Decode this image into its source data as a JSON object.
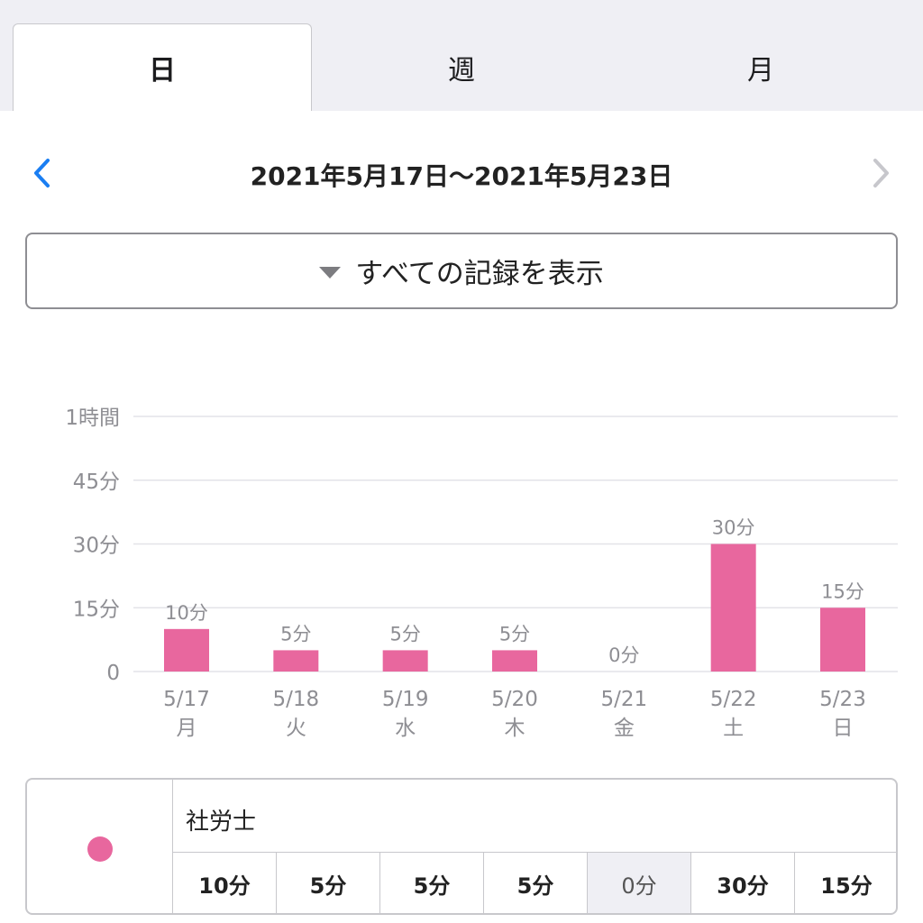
{
  "tabs": {
    "day": "日",
    "week": "週",
    "month": "月"
  },
  "date_range": "2021年5月17日〜2021年5月23日",
  "filter_label": "すべての記録を表示",
  "colors": {
    "bar": "#e8679e",
    "accent": "#1a7ef2",
    "disabled": "#c7c7cc"
  },
  "chart_data": {
    "type": "bar",
    "categories": [
      "5/17",
      "5/18",
      "5/19",
      "5/20",
      "5/21",
      "5/22",
      "5/23"
    ],
    "weekdays": [
      "月",
      "火",
      "水",
      "木",
      "金",
      "土",
      "日"
    ],
    "values": [
      10,
      5,
      5,
      5,
      0,
      30,
      15
    ],
    "value_labels": [
      "10分",
      "5分",
      "5分",
      "5分",
      "0分",
      "30分",
      "15分"
    ],
    "ylim": [
      0,
      60
    ],
    "yticks": [
      0,
      15,
      30,
      45,
      60
    ],
    "ytick_labels": [
      "0",
      "15分",
      "30分",
      "45分",
      "1時間"
    ],
    "grid": true
  },
  "legend": {
    "name": "社労士",
    "values": [
      "10分",
      "5分",
      "5分",
      "5分",
      "0分",
      "30分",
      "15分"
    ]
  }
}
